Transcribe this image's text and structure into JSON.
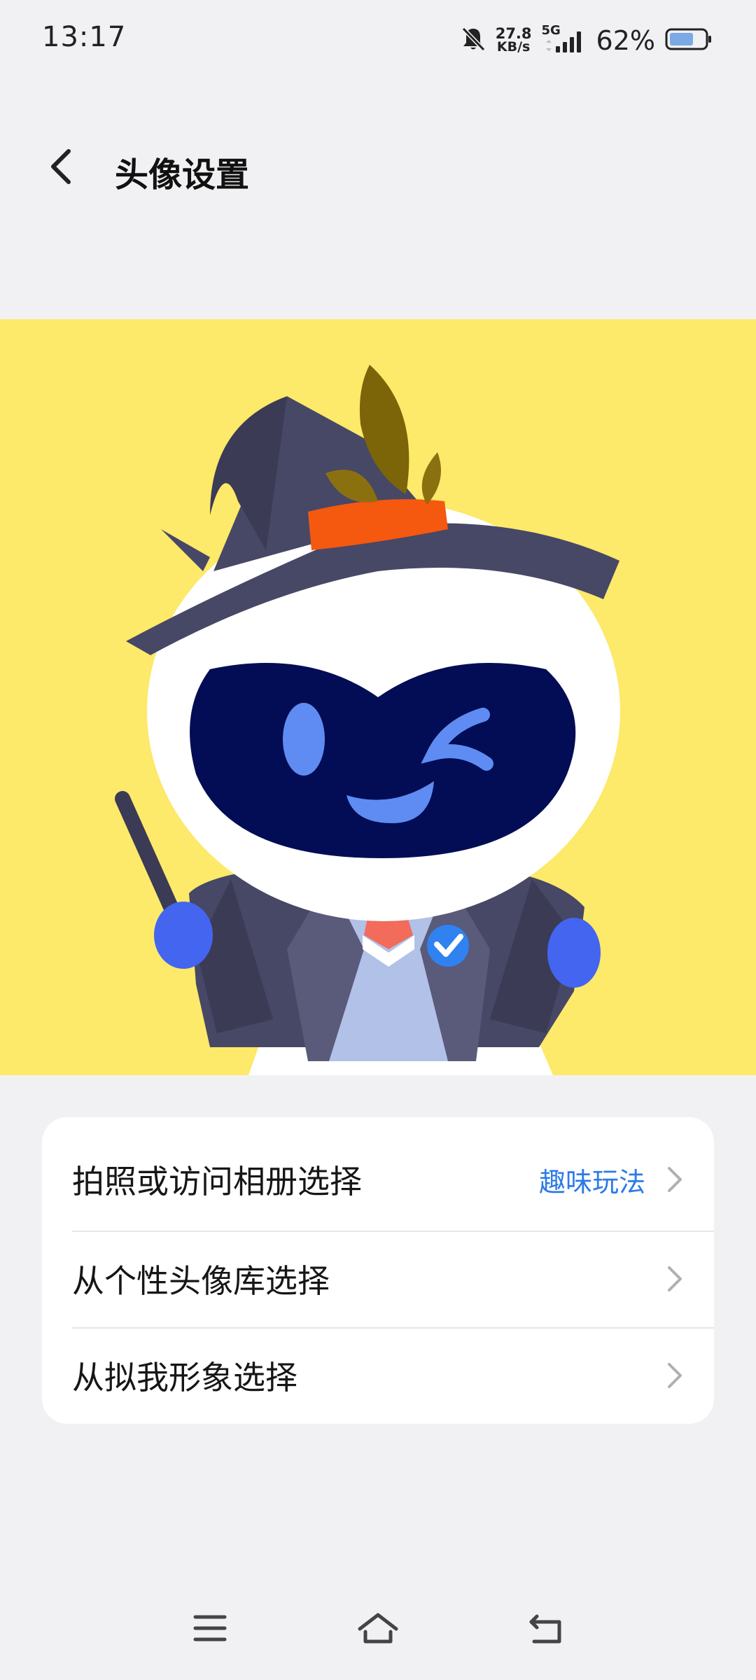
{
  "status_bar": {
    "time": "13:17",
    "net_speed_value": "27.8",
    "net_speed_unit": "KB/s",
    "network_type": "5G",
    "battery_percent": "62%",
    "battery_level": 0.62,
    "icons": [
      "bell-muted-icon",
      "signal-icon",
      "battery-icon"
    ]
  },
  "header": {
    "back_icon": "back-arrow-icon",
    "title": "头像设置"
  },
  "avatar": {
    "background_color": "#fde96a",
    "description_icon": "robot-mascot-wizard"
  },
  "options": [
    {
      "label": "拍照或访问相册选择",
      "extra": "趣味玩法",
      "icon": "chevron-right-icon"
    },
    {
      "label": "从个性头像库选择",
      "extra": "",
      "icon": "chevron-right-icon"
    },
    {
      "label": "从拟我形象选择",
      "extra": "",
      "icon": "chevron-right-icon"
    }
  ],
  "nav_bar": {
    "menu_icon": "menu-icon",
    "home_icon": "home-icon",
    "back_icon": "back-icon"
  },
  "colors": {
    "page_background": "#f1f1f3",
    "accent": "#2d7be5",
    "card_background": "#ffffff"
  }
}
